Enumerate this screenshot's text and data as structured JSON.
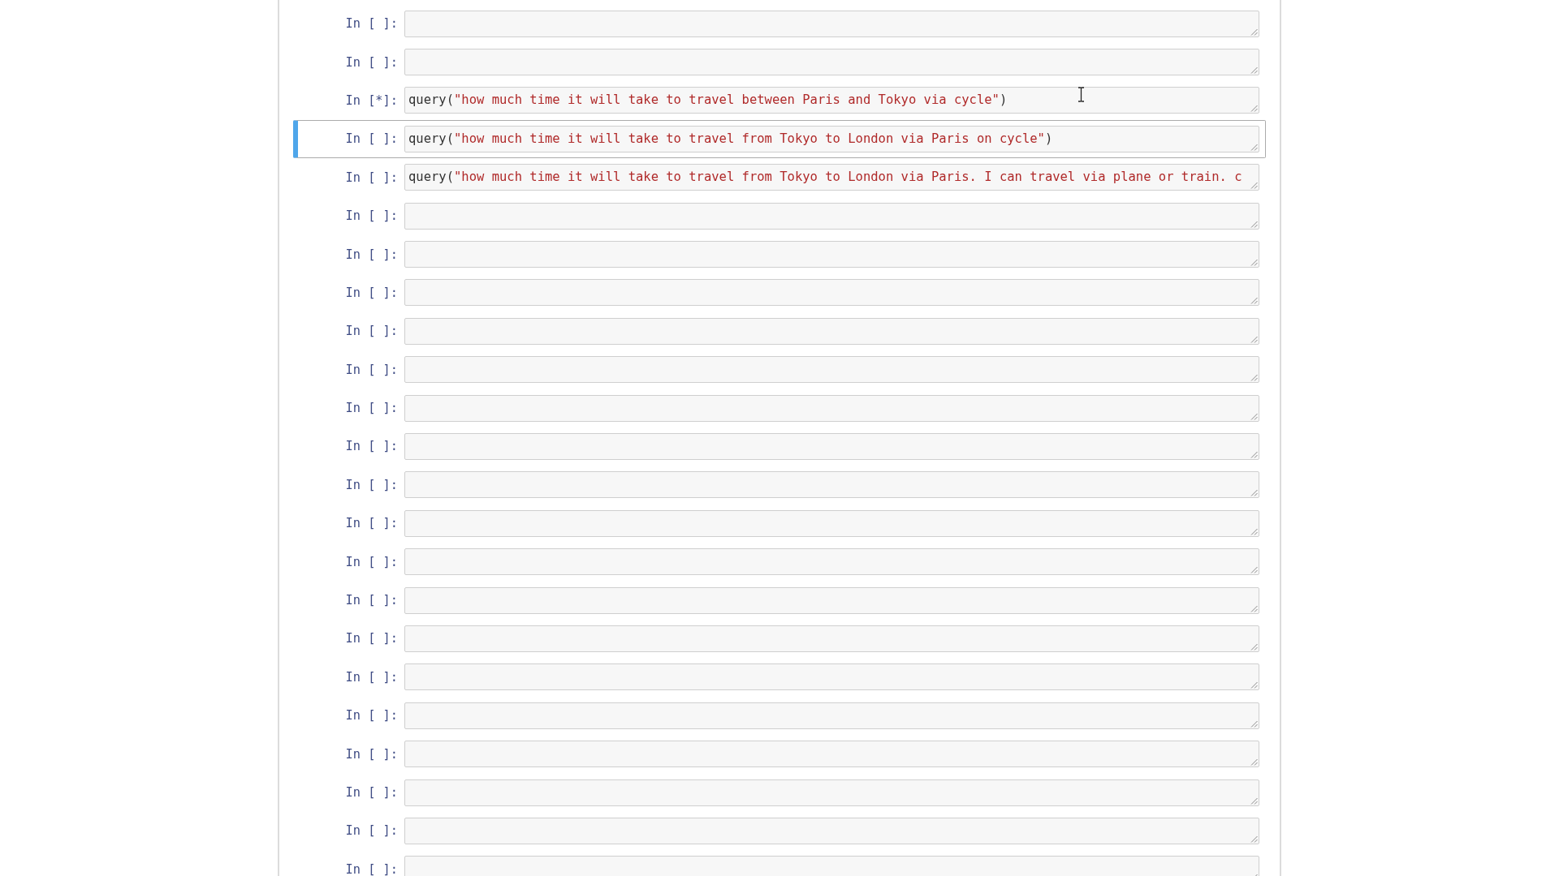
{
  "cells": [
    {
      "prompt": "In [ ]:",
      "selected": false
    },
    {
      "prompt": "In [ ]:",
      "selected": false
    },
    {
      "prompt": "In [*]:",
      "selected": false,
      "code": [
        {
          "kind": "default",
          "text": "query("
        },
        {
          "kind": "string",
          "text": "\"how much time it will take to travel between Paris and Tokyo via cycle\""
        },
        {
          "kind": "default",
          "text": ")"
        }
      ]
    },
    {
      "prompt": "In [ ]:",
      "selected": true,
      "code": [
        {
          "kind": "default",
          "text": "query("
        },
        {
          "kind": "string",
          "text": "\"how much time it will take to travel from Tokyo to London via Paris on cycle\""
        },
        {
          "kind": "default",
          "text": ")"
        }
      ]
    },
    {
      "prompt": "In [ ]:",
      "selected": false,
      "code": [
        {
          "kind": "default",
          "text": "query("
        },
        {
          "kind": "string",
          "text": "\"how much time it will take to travel from Tokyo to London via Paris. I can travel via plane or train. c"
        }
      ]
    },
    {
      "prompt": "In [ ]:",
      "selected": false
    },
    {
      "prompt": "In [ ]:",
      "selected": false
    },
    {
      "prompt": "In [ ]:",
      "selected": false
    },
    {
      "prompt": "In [ ]:",
      "selected": false
    },
    {
      "prompt": "In [ ]:",
      "selected": false
    },
    {
      "prompt": "In [ ]:",
      "selected": false
    },
    {
      "prompt": "In [ ]:",
      "selected": false
    },
    {
      "prompt": "In [ ]:",
      "selected": false
    },
    {
      "prompt": "In [ ]:",
      "selected": false
    },
    {
      "prompt": "In [ ]:",
      "selected": false
    },
    {
      "prompt": "In [ ]:",
      "selected": false
    },
    {
      "prompt": "In [ ]:",
      "selected": false
    },
    {
      "prompt": "In [ ]:",
      "selected": false
    },
    {
      "prompt": "In [ ]:",
      "selected": false
    },
    {
      "prompt": "In [ ]:",
      "selected": false
    },
    {
      "prompt": "In [ ]:",
      "selected": false
    },
    {
      "prompt": "In [ ]:",
      "selected": false
    },
    {
      "prompt": "In [ ]:",
      "selected": false
    }
  ]
}
